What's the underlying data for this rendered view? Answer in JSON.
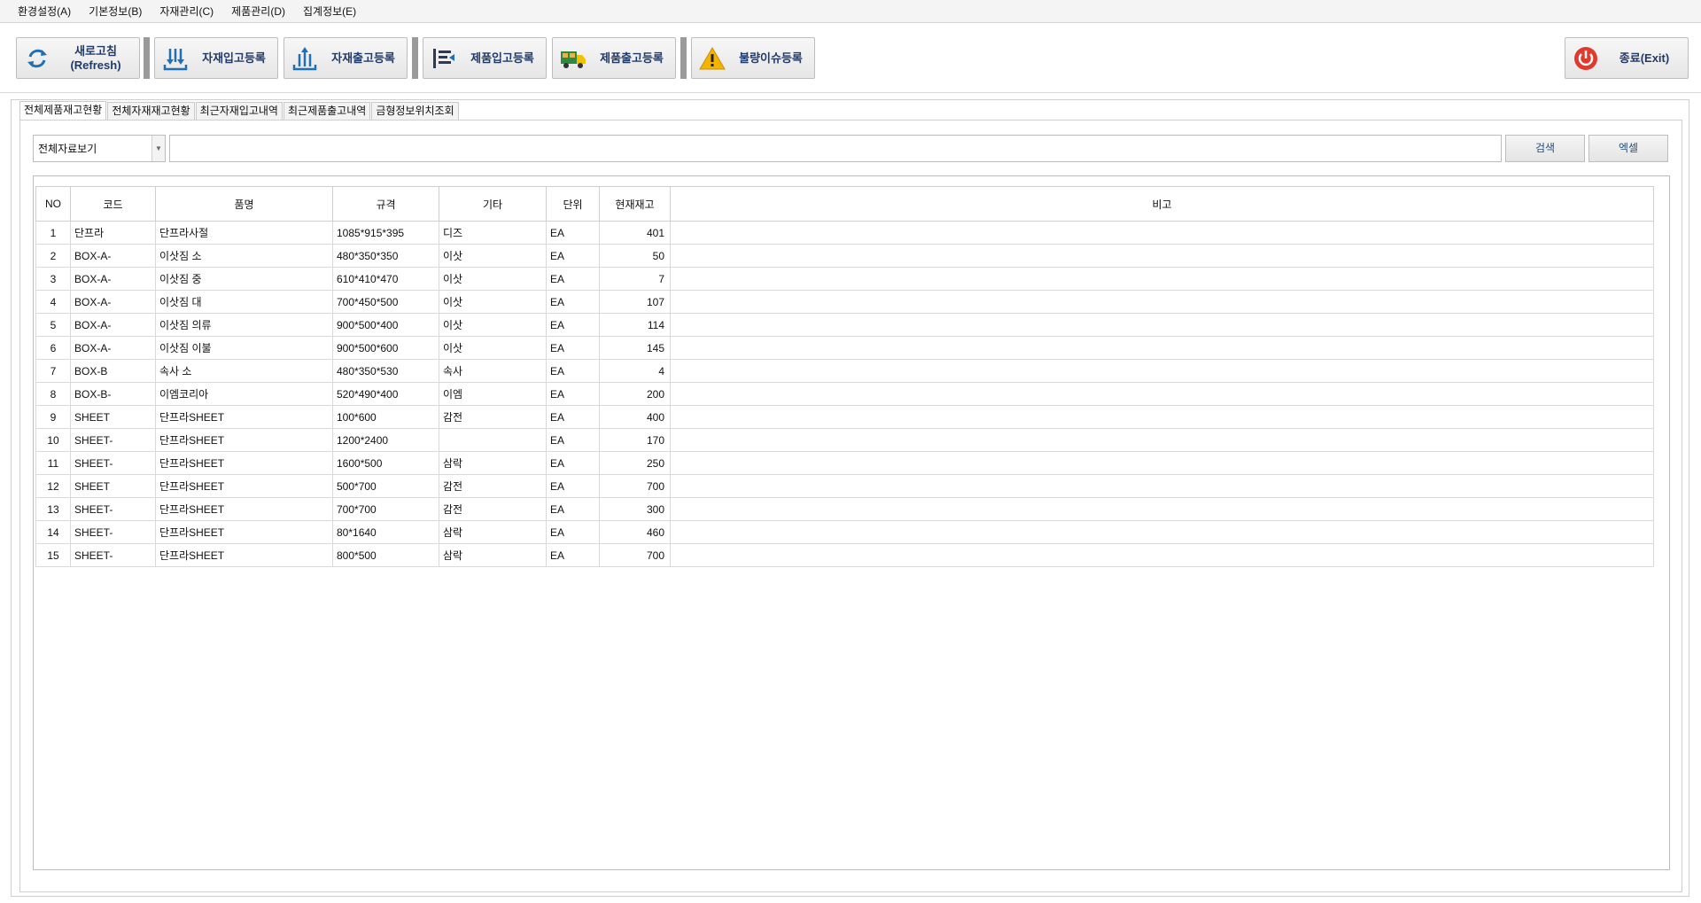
{
  "menu": [
    {
      "label": "환경설정(A)"
    },
    {
      "label": "기본정보(B)"
    },
    {
      "label": "자재관리(C)"
    },
    {
      "label": "제품관리(D)"
    },
    {
      "label": "집계정보(E)"
    }
  ],
  "toolbar": {
    "refresh_label": "새로고침\n(Refresh)",
    "material_in_label": "자재입고등록",
    "material_out_label": "자재출고등록",
    "product_in_label": "제품입고등록",
    "product_out_label": "제품출고등록",
    "defect_label": "불량이슈등록",
    "exit_label": "종료(Exit)"
  },
  "tabs": [
    {
      "label": "전체제품재고현황",
      "active": true
    },
    {
      "label": "전체자재재고현황"
    },
    {
      "label": "최근자재입고내역"
    },
    {
      "label": "최근제품출고내역"
    },
    {
      "label": "금형정보위치조회"
    }
  ],
  "search": {
    "filter_value": "전체자료보기",
    "query_value": "",
    "search_label": "검색",
    "excel_label": "엑셀"
  },
  "grid": {
    "columns": [
      "NO",
      "코드",
      "품명",
      "규격",
      "기타",
      "단위",
      "현재재고",
      "비고"
    ],
    "rows": [
      {
        "no": "1",
        "code": "단프라",
        "name": "단프라사절",
        "spec": "1085*915*395",
        "etc": "디즈",
        "unit": "EA",
        "qty": "401",
        "note": ""
      },
      {
        "no": "2",
        "code": "BOX-A-",
        "name": "이삿짐 소",
        "spec": "480*350*350",
        "etc": "이삿",
        "unit": "EA",
        "qty": "50",
        "note": ""
      },
      {
        "no": "3",
        "code": "BOX-A-",
        "name": "이삿짐 중",
        "spec": "610*410*470",
        "etc": "이삿",
        "unit": "EA",
        "qty": "7",
        "note": ""
      },
      {
        "no": "4",
        "code": "BOX-A-",
        "name": "이삿짐 대",
        "spec": "700*450*500",
        "etc": "이삿",
        "unit": "EA",
        "qty": "107",
        "note": ""
      },
      {
        "no": "5",
        "code": "BOX-A-",
        "name": "이삿짐 의류",
        "spec": "900*500*400",
        "etc": "이삿",
        "unit": "EA",
        "qty": "114",
        "note": ""
      },
      {
        "no": "6",
        "code": "BOX-A-",
        "name": "이삿짐 이불",
        "spec": "900*500*600",
        "etc": "이삿",
        "unit": "EA",
        "qty": "145",
        "note": ""
      },
      {
        "no": "7",
        "code": "BOX-B",
        "name": "속사 소",
        "spec": "480*350*530",
        "etc": "속사",
        "unit": "EA",
        "qty": "4",
        "note": ""
      },
      {
        "no": "8",
        "code": "BOX-B-",
        "name": "이엠코리아",
        "spec": "520*490*400",
        "etc": "이엠",
        "unit": "EA",
        "qty": "200",
        "note": ""
      },
      {
        "no": "9",
        "code": "SHEET",
        "name": "단프라SHEET",
        "spec": "100*600",
        "etc": "감전",
        "unit": "EA",
        "qty": "400",
        "note": ""
      },
      {
        "no": "10",
        "code": "SHEET-",
        "name": "단프라SHEET",
        "spec": "1200*2400",
        "etc": "",
        "unit": "EA",
        "qty": "170",
        "note": ""
      },
      {
        "no": "11",
        "code": "SHEET-",
        "name": "단프라SHEET",
        "spec": "1600*500",
        "etc": "삼락",
        "unit": "EA",
        "qty": "250",
        "note": ""
      },
      {
        "no": "12",
        "code": "SHEET",
        "name": "단프라SHEET",
        "spec": "500*700",
        "etc": "감전",
        "unit": "EA",
        "qty": "700",
        "note": ""
      },
      {
        "no": "13",
        "code": "SHEET-",
        "name": "단프라SHEET",
        "spec": "700*700",
        "etc": "감전",
        "unit": "EA",
        "qty": "300",
        "note": ""
      },
      {
        "no": "14",
        "code": "SHEET-",
        "name": "단프라SHEET",
        "spec": "80*1640",
        "etc": "삼락",
        "unit": "EA",
        "qty": "460",
        "note": ""
      },
      {
        "no": "15",
        "code": "SHEET-",
        "name": "단프라SHEET",
        "spec": "800*500",
        "etc": "삼락",
        "unit": "EA",
        "qty": "700",
        "note": ""
      }
    ]
  },
  "colors": {
    "refresh_icon": "#1f6fb5",
    "exit_icon": "#e03a2f",
    "warning_icon": "#f2b400",
    "truck_icon": "#2e8b3e"
  }
}
